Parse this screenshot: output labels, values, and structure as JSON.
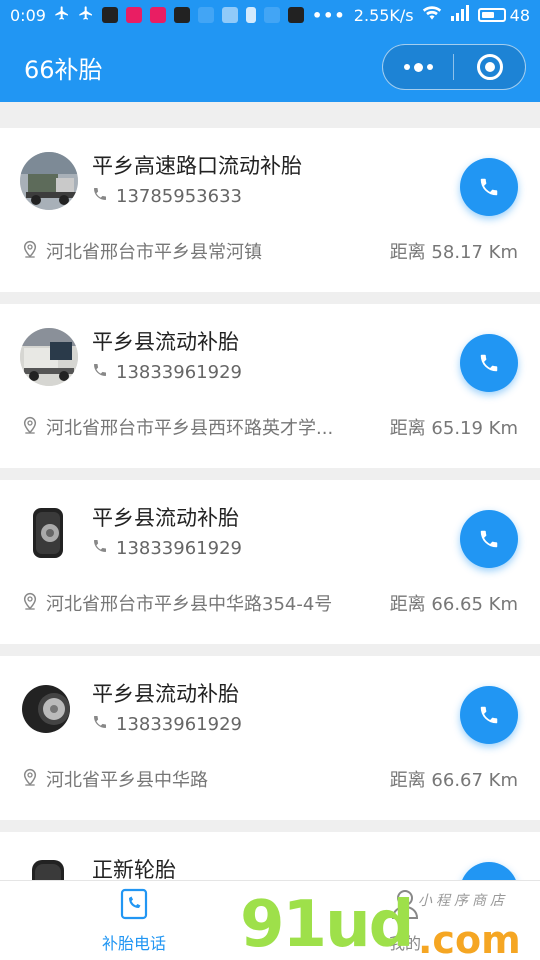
{
  "status_bar": {
    "time": "0:09",
    "speed": "2.55K/s",
    "battery": "48"
  },
  "header": {
    "title": "66补胎"
  },
  "shops": [
    {
      "name": "平乡高速路口流动补胎",
      "phone": "13785953633",
      "address": "河北省邢台市平乡县常河镇",
      "distance": "距离 58.17 Km"
    },
    {
      "name": "平乡县流动补胎",
      "phone": "13833961929",
      "address": "河北省邢台市平乡县西环路英才学...",
      "distance": "距离 65.19 Km"
    },
    {
      "name": "平乡县流动补胎",
      "phone": "13833961929",
      "address": "河北省邢台市平乡县中华路354-4号",
      "distance": "距离 66.65 Km"
    },
    {
      "name": "平乡县流动补胎",
      "phone": "13833961929",
      "address": "河北省平乡县中华路",
      "distance": "距离 66.67 Km"
    },
    {
      "name": "正新轮胎",
      "phone": "",
      "address": "",
      "distance": ""
    }
  ],
  "tabbar": {
    "tab_phone": "补胎电话",
    "tab_me": "我的"
  },
  "watermark": {
    "big": "91ud",
    "com": ".com",
    "small": "小程序商店"
  },
  "colors": {
    "primary": "#2196f3",
    "background": "#efefef"
  }
}
